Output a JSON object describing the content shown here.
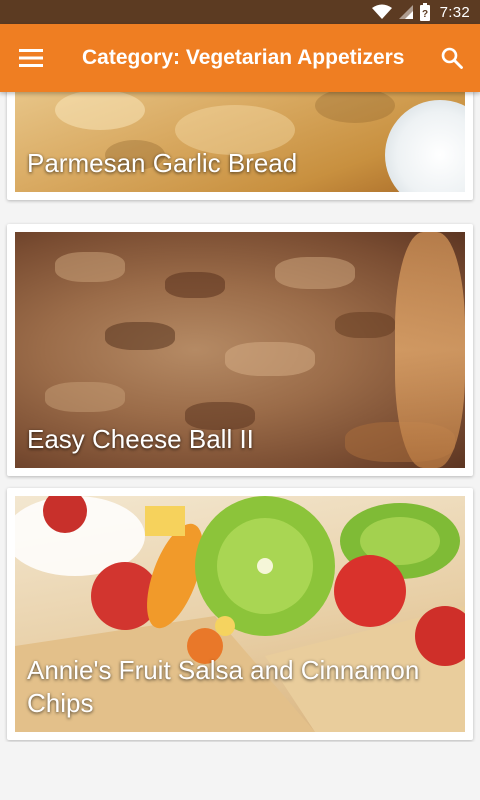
{
  "status_bar": {
    "time": "7:32"
  },
  "app_bar": {
    "title": "Category: Vegetarian Appetizers"
  },
  "recipes": [
    {
      "title": "Parmesan Garlic Bread"
    },
    {
      "title": "Easy Cheese Ball II"
    },
    {
      "title": "Annie's Fruit Salsa and Cinnamon Chips"
    }
  ],
  "colors": {
    "status_bar": "#5c3b22",
    "app_bar": "#ef7e22",
    "background": "#f4f4f4"
  }
}
